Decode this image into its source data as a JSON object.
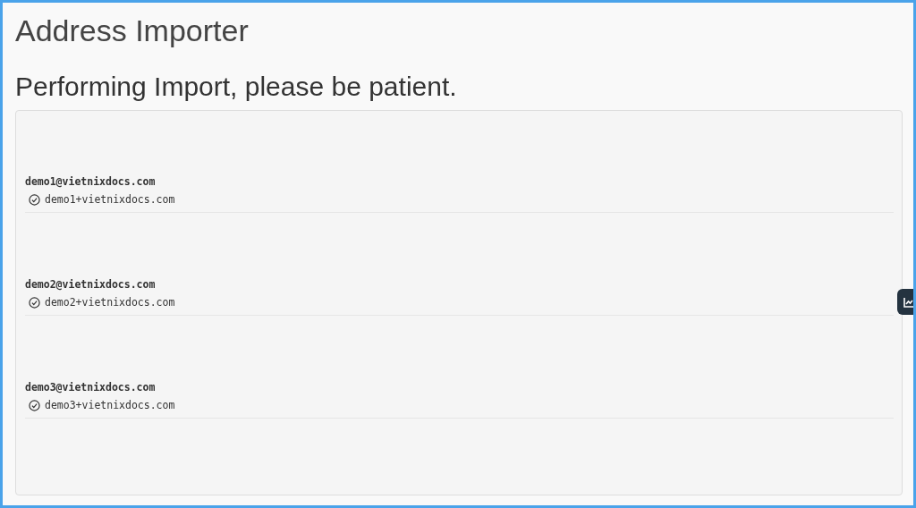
{
  "page": {
    "title": "Address Importer",
    "heading": "Performing Import, please be patient."
  },
  "imports": [
    {
      "source": "demo1@vietnixdocs.com",
      "result": "demo1+vietnixdocs.com"
    },
    {
      "source": "demo2@vietnixdocs.com",
      "result": "demo2+vietnixdocs.com"
    },
    {
      "source": "demo3@vietnixdocs.com",
      "result": "demo3+vietnixdocs.com"
    }
  ]
}
